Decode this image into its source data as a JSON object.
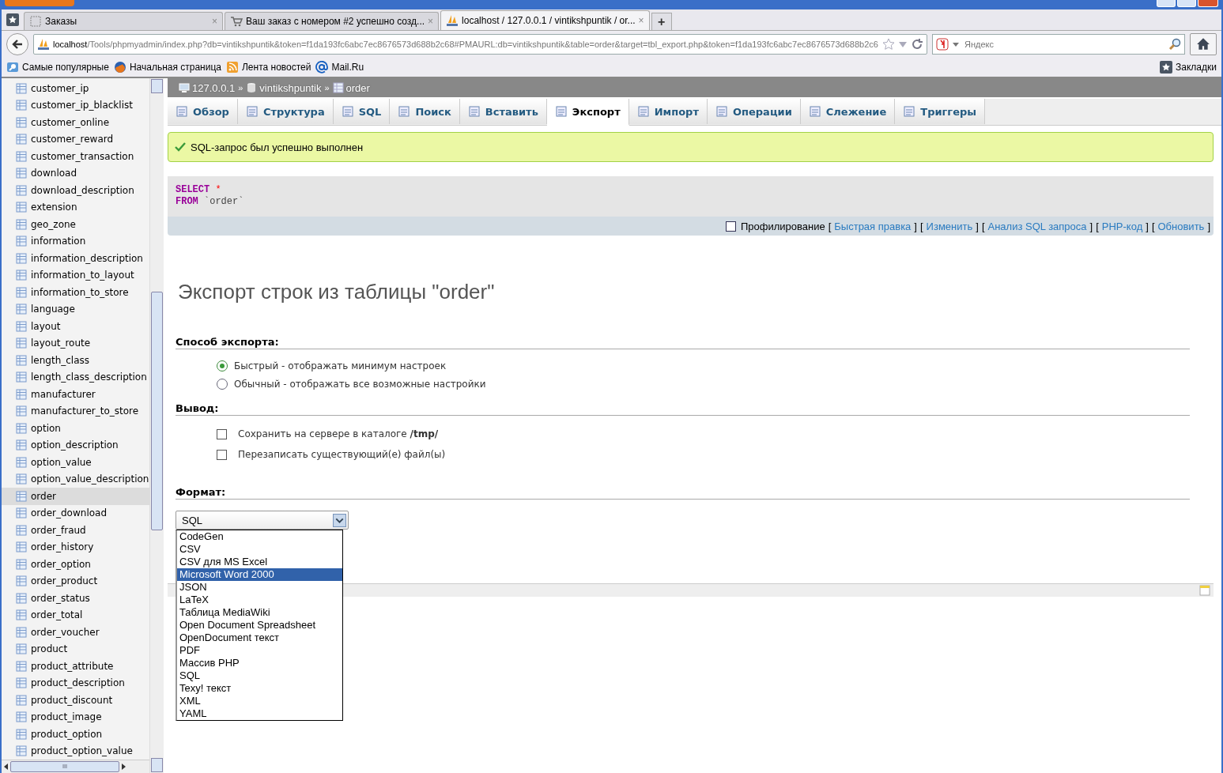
{
  "browser": {
    "tabs": [
      {
        "title": "Заказы",
        "selected": false,
        "kind": "blank"
      },
      {
        "title": "Ваш заказ с номером #2 успешно созд...",
        "selected": false,
        "kind": "cart"
      },
      {
        "title": "localhost / 127.0.0.1 / vintikshpuntik / or...",
        "selected": true,
        "kind": "pma"
      }
    ],
    "new_tab": "+",
    "close": "×",
    "url_host": "localhost",
    "url_rest": "/Tools/phpmyadmin/index.php?db=vintikshpuntik&token=f1da193fc6abc7ec8676573d688b2c68#PMAURL:db=vintikshpuntik&table=order&target=tbl_export.php&token=f1da193fc6abc7ec8676573d688b2c6",
    "search": {
      "placeholder": "Яндекс"
    },
    "bookmarks": [
      {
        "label": "Самые популярные",
        "kind": "search"
      },
      {
        "label": "Начальная страница",
        "kind": "fox"
      },
      {
        "label": "Лента новостей",
        "kind": "rss"
      },
      {
        "label": "Mail.Ru",
        "kind": "at"
      }
    ],
    "bookmarks_menu": "Закладки"
  },
  "sidebar": {
    "items": [
      {
        "label": "customer_ip",
        "selected": false
      },
      {
        "label": "customer_ip_blacklist",
        "selected": false
      },
      {
        "label": "customer_online",
        "selected": false
      },
      {
        "label": "customer_reward",
        "selected": false
      },
      {
        "label": "customer_transaction",
        "selected": false
      },
      {
        "label": "download",
        "selected": false
      },
      {
        "label": "download_description",
        "selected": false
      },
      {
        "label": "extension",
        "selected": false
      },
      {
        "label": "geo_zone",
        "selected": false
      },
      {
        "label": "information",
        "selected": false
      },
      {
        "label": "information_description",
        "selected": false
      },
      {
        "label": "information_to_layout",
        "selected": false
      },
      {
        "label": "information_to_store",
        "selected": false
      },
      {
        "label": "language",
        "selected": false
      },
      {
        "label": "layout",
        "selected": false
      },
      {
        "label": "layout_route",
        "selected": false
      },
      {
        "label": "length_class",
        "selected": false
      },
      {
        "label": "length_class_description",
        "selected": false
      },
      {
        "label": "manufacturer",
        "selected": false
      },
      {
        "label": "manufacturer_to_store",
        "selected": false
      },
      {
        "label": "option",
        "selected": false
      },
      {
        "label": "option_description",
        "selected": false
      },
      {
        "label": "option_value",
        "selected": false
      },
      {
        "label": "option_value_description",
        "selected": false
      },
      {
        "label": "order",
        "selected": true
      },
      {
        "label": "order_download",
        "selected": false
      },
      {
        "label": "order_fraud",
        "selected": false
      },
      {
        "label": "order_history",
        "selected": false
      },
      {
        "label": "order_option",
        "selected": false
      },
      {
        "label": "order_product",
        "selected": false
      },
      {
        "label": "order_status",
        "selected": false
      },
      {
        "label": "order_total",
        "selected": false
      },
      {
        "label": "order_voucher",
        "selected": false
      },
      {
        "label": "product",
        "selected": false
      },
      {
        "label": "product_attribute",
        "selected": false
      },
      {
        "label": "product_description",
        "selected": false
      },
      {
        "label": "product_discount",
        "selected": false
      },
      {
        "label": "product_image",
        "selected": false
      },
      {
        "label": "product_option",
        "selected": false
      },
      {
        "label": "product_option_value",
        "selected": false
      }
    ]
  },
  "breadcrumb": [
    {
      "label": "127.0.0.1",
      "kind": "server"
    },
    {
      "label": "vintikshpuntik",
      "kind": "db"
    },
    {
      "label": "order",
      "kind": "table"
    }
  ],
  "breadcrumb_sep": "»",
  "tabs": [
    {
      "label": "Обзор",
      "selected": false
    },
    {
      "label": "Структура",
      "selected": false
    },
    {
      "label": "SQL",
      "selected": false
    },
    {
      "label": "Поиск",
      "selected": false
    },
    {
      "label": "Вставить",
      "selected": false
    },
    {
      "label": "Экспорт",
      "selected": true
    },
    {
      "label": "Импорт",
      "selected": false
    },
    {
      "label": "Операции",
      "selected": false
    },
    {
      "label": "Слежение",
      "selected": false
    },
    {
      "label": "Триггеры",
      "selected": false
    }
  ],
  "message": "SQL-запрос был успешно выполнен",
  "query": {
    "select": "SELECT",
    "star": "*",
    "from": "FROM",
    "table": "`order`"
  },
  "query_links": {
    "profiling": {
      "label": "Профилирование",
      "checked": false
    },
    "links": [
      {
        "open": "[",
        "label": "Быстрая правка",
        "close": "]"
      },
      {
        "open": "[",
        "label": "Изменить",
        "close": "]"
      },
      {
        "open": "[",
        "label": "Анализ SQL запроса",
        "close": "]"
      },
      {
        "open": "[",
        "label": "PHP-код",
        "close": "]"
      },
      {
        "open": "[",
        "label": "Обновить",
        "close": "]"
      }
    ]
  },
  "heading": "Экспорт строк из таблицы \"order\"",
  "method": {
    "title": "Способ экспорта:",
    "options": [
      {
        "label": "Быстрый - отображать минимум настроек",
        "selected": true
      },
      {
        "label": "Обычный - отображать все возможные настройки",
        "selected": false
      }
    ]
  },
  "output": {
    "title": "Вывод:",
    "options": [
      {
        "label": "Сохранить на сервере в каталоге **/tmp/**",
        "checked": false
      },
      {
        "label": "Перезаписать существующий(е) файл(ы)",
        "checked": false
      }
    ]
  },
  "format": {
    "title": "Формат:",
    "value": "SQL",
    "options": [
      {
        "label": "CodeGen",
        "highlighted": false
      },
      {
        "label": "CSV",
        "highlighted": false
      },
      {
        "label": "CSV для MS Excel",
        "highlighted": false
      },
      {
        "label": "Microsoft Word 2000",
        "highlighted": true
      },
      {
        "label": "JSON",
        "highlighted": false
      },
      {
        "label": "LaTeX",
        "highlighted": false
      },
      {
        "label": "Таблица MediaWiki",
        "highlighted": false
      },
      {
        "label": "Open Document Spreadsheet",
        "highlighted": false
      },
      {
        "label": "OpenDocument текст",
        "highlighted": false
      },
      {
        "label": "PDF",
        "highlighted": false
      },
      {
        "label": "Массив PHP",
        "highlighted": false
      },
      {
        "label": "SQL",
        "highlighted": false
      },
      {
        "label": "Texy! текст",
        "highlighted": false
      },
      {
        "label": "XML",
        "highlighted": false
      },
      {
        "label": "YAML",
        "highlighted": false
      }
    ]
  },
  "scrollbar_grip": "III"
}
